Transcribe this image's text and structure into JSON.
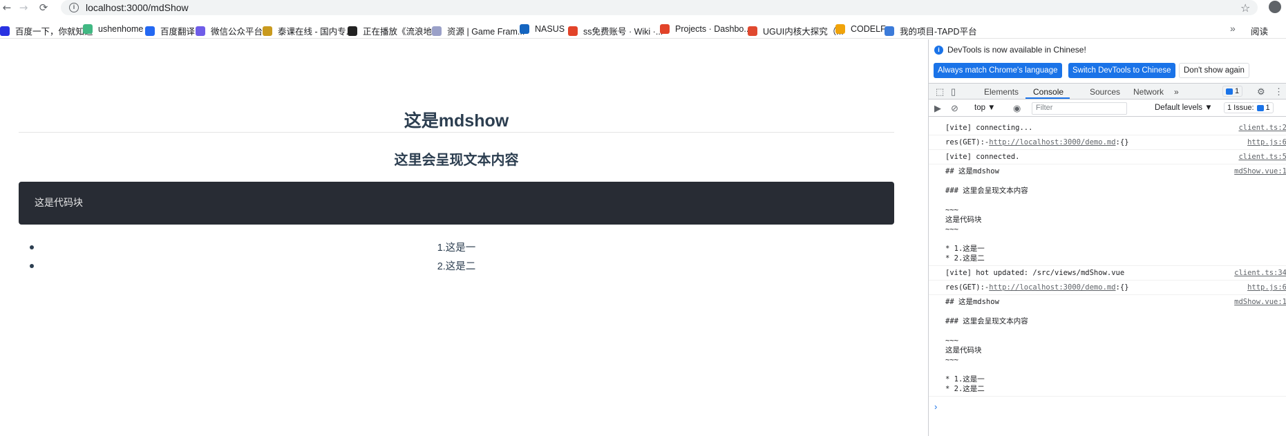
{
  "browser": {
    "url": "localhost:3000/mdShow",
    "bookmarks": [
      {
        "label": "百度一下，你就知道",
        "color": "#2932e1"
      },
      {
        "label": "ushenhome",
        "color": "#41b883"
      },
      {
        "label": "百度翻译",
        "color": "#2468f2"
      },
      {
        "label": "微信公众平台",
        "color": "#6f5de8"
      },
      {
        "label": "泰课在线 - 国内专...",
        "color": "#c99a1e"
      },
      {
        "label": "正在播放《流浪地...",
        "color": "#222222"
      },
      {
        "label": "资源 | Game Fram...",
        "color": "#9aa0c8"
      },
      {
        "label": "NASUS",
        "color": "#1565c0"
      },
      {
        "label": "ss免费账号 · Wiki ·...",
        "color": "#e24329"
      },
      {
        "label": "Projects · Dashbo...",
        "color": "#e24329"
      },
      {
        "label": "UGUI内核大探究（...",
        "color": "#e0492f"
      },
      {
        "label": "CODELF",
        "color": "#f0a30a"
      },
      {
        "label": "我的项目-TAPD平台",
        "color": "#3c7bd9"
      }
    ],
    "more": "»",
    "reading_list": "阅读"
  },
  "page": {
    "h2": "这是mdshow",
    "h3": "这里会呈现文本内容",
    "code": "这是代码块",
    "list": [
      "1.这是一",
      "2.这是二"
    ]
  },
  "devtools": {
    "notice": "DevTools is now available in Chinese!",
    "btn_match": "Always match Chrome's language",
    "btn_switch": "Switch DevTools to Chinese",
    "btn_dont": "Don't show again",
    "tabs": [
      "Elements",
      "Console",
      "Sources",
      "Network"
    ],
    "tabs_more": "»",
    "msg_count": "1",
    "context": "top ▼",
    "filter_placeholder": "Filter",
    "levels": "Default levels ▼",
    "issues": "1 Issue:",
    "issues_count": "1",
    "console_lines": [
      {
        "text": "[vite] connecting...",
        "src": "client.ts:2"
      },
      {
        "text": "res(GET):-http://localhost:3000/demo.md:{}",
        "src": "http.js:6"
      },
      {
        "text": "[vite] connected.",
        "src": "client.ts:5"
      },
      {
        "text": "## 这是mdshow\n\n### 这里会呈现文本内容\n\n~~~\n这是代码块\n~~~\n\n* 1.这是一\n* 2.这是二",
        "src": "mdShow.vue:1"
      },
      {
        "text": "[vite] hot updated: /src/views/mdShow.vue",
        "src": "client.ts:34"
      },
      {
        "text": "res(GET):-http://localhost:3000/demo.md:{}",
        "src": "http.js:6"
      },
      {
        "text": "## 这是mdshow\n\n### 这里会呈现文本内容\n\n~~~\n这是代码块\n~~~\n\n* 1.这是一\n* 2.这是二",
        "src": "mdShow.vue:1"
      }
    ],
    "prompt": "›"
  }
}
